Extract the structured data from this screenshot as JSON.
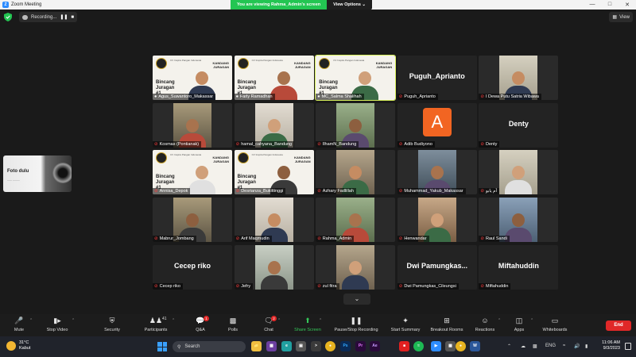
{
  "window": {
    "title": "Zoom Meeting",
    "viewing_banner": "You are viewing Rahma_Admin's screen",
    "view_options_label": "View Options",
    "controls": [
      "—",
      "□",
      "✕"
    ]
  },
  "topbar": {
    "recording_label": "Recording...",
    "view_label": "View"
  },
  "selfview": {
    "title": "Foto dulu",
    "subtitle": "—— ———"
  },
  "banner": {
    "heading": "Bincang Juragan #1",
    "small": "CV Inspira Pangan Indonesia",
    "brand": "KANDANG JURAGAN"
  },
  "participants": [
    {
      "name": "Agus_Suwantoro_Makassar",
      "kind": "banner",
      "muted": false
    },
    {
      "name": "Farly Ramadhan",
      "kind": "banner",
      "muted": false
    },
    {
      "name": "MC_Salma Shalihah",
      "kind": "banner",
      "muted": false,
      "speaking": true
    },
    {
      "name": "Puguh_Aprianto",
      "kind": "name",
      "muted": true
    },
    {
      "name": "I Dewa Putu Satria Wibawa",
      "kind": "video",
      "muted": true
    },
    {
      "name": "Kosmas (Pontianak)",
      "kind": "video",
      "muted": true
    },
    {
      "name": "hamal_cahyana_Bandung",
      "kind": "video",
      "muted": true
    },
    {
      "name": "IlhamN_Bandung",
      "kind": "video",
      "muted": true
    },
    {
      "name": "Adib Budiyono",
      "kind": "avatar",
      "avatar_letter": "A",
      "muted": true
    },
    {
      "name": "Denty",
      "kind": "name",
      "muted": true
    },
    {
      "name": "Annisa_Depok",
      "kind": "banner",
      "muted": true
    },
    {
      "name": "Desrianza_Bukittinggi",
      "kind": "banner",
      "muted": true
    },
    {
      "name": "Azhary Fadlillah",
      "kind": "video",
      "muted": true
    },
    {
      "name": "Muhammad_Yakub_Makassar",
      "kind": "video",
      "muted": true
    },
    {
      "name": "أم يابو",
      "kind": "video",
      "muted": true
    },
    {
      "name": "Mabrur_Jombang",
      "kind": "video",
      "muted": true
    },
    {
      "name": "Arif Maqmudin",
      "kind": "video",
      "muted": true
    },
    {
      "name": "Rahma_Admin",
      "kind": "video",
      "muted": true
    },
    {
      "name": "Henwandar",
      "kind": "video",
      "muted": true
    },
    {
      "name": "Raul Sandi",
      "kind": "video",
      "muted": true
    },
    {
      "name": "Cecep riko",
      "kind": "name",
      "big_name": "Cecep riko",
      "muted": true
    },
    {
      "name": "Jefry",
      "kind": "video",
      "muted": true
    },
    {
      "name": "zul fitra",
      "kind": "video",
      "muted": true
    },
    {
      "name": "Dwi Pamungkas_Cileungsi",
      "kind": "name",
      "big_name": "Dwi Pamungkas...",
      "muted": true
    },
    {
      "name": "Miftahuddin",
      "kind": "name",
      "muted": true
    }
  ],
  "toolbar": {
    "mute": "Mute",
    "stop_video": "Stop Video",
    "security": "Security",
    "participants": "Participants",
    "participants_count": "41",
    "qa": "Q&A",
    "qa_badge": "1",
    "polls": "Polls",
    "chat": "Chat",
    "chat_badge": "2",
    "share_screen": "Share Screen",
    "record": "Pause/Stop Recording",
    "summary": "Start Summary",
    "breakout": "Breakout Rooms",
    "reactions": "Reactions",
    "apps": "Apps",
    "whiteboards": "Whiteboards",
    "end": "End"
  },
  "taskbar": {
    "temperature": "31°C",
    "weather": "Kabut",
    "search_placeholder": "Search",
    "language": "ENG",
    "time": "11:06 AM",
    "date": "9/3/2023"
  },
  "colors": {
    "accent_green": "#23c552",
    "end_red": "#e02828",
    "muted_icon": "#ff3b3b",
    "avatar_orange": "#f26522",
    "active_speaker": "#d8f05a"
  }
}
